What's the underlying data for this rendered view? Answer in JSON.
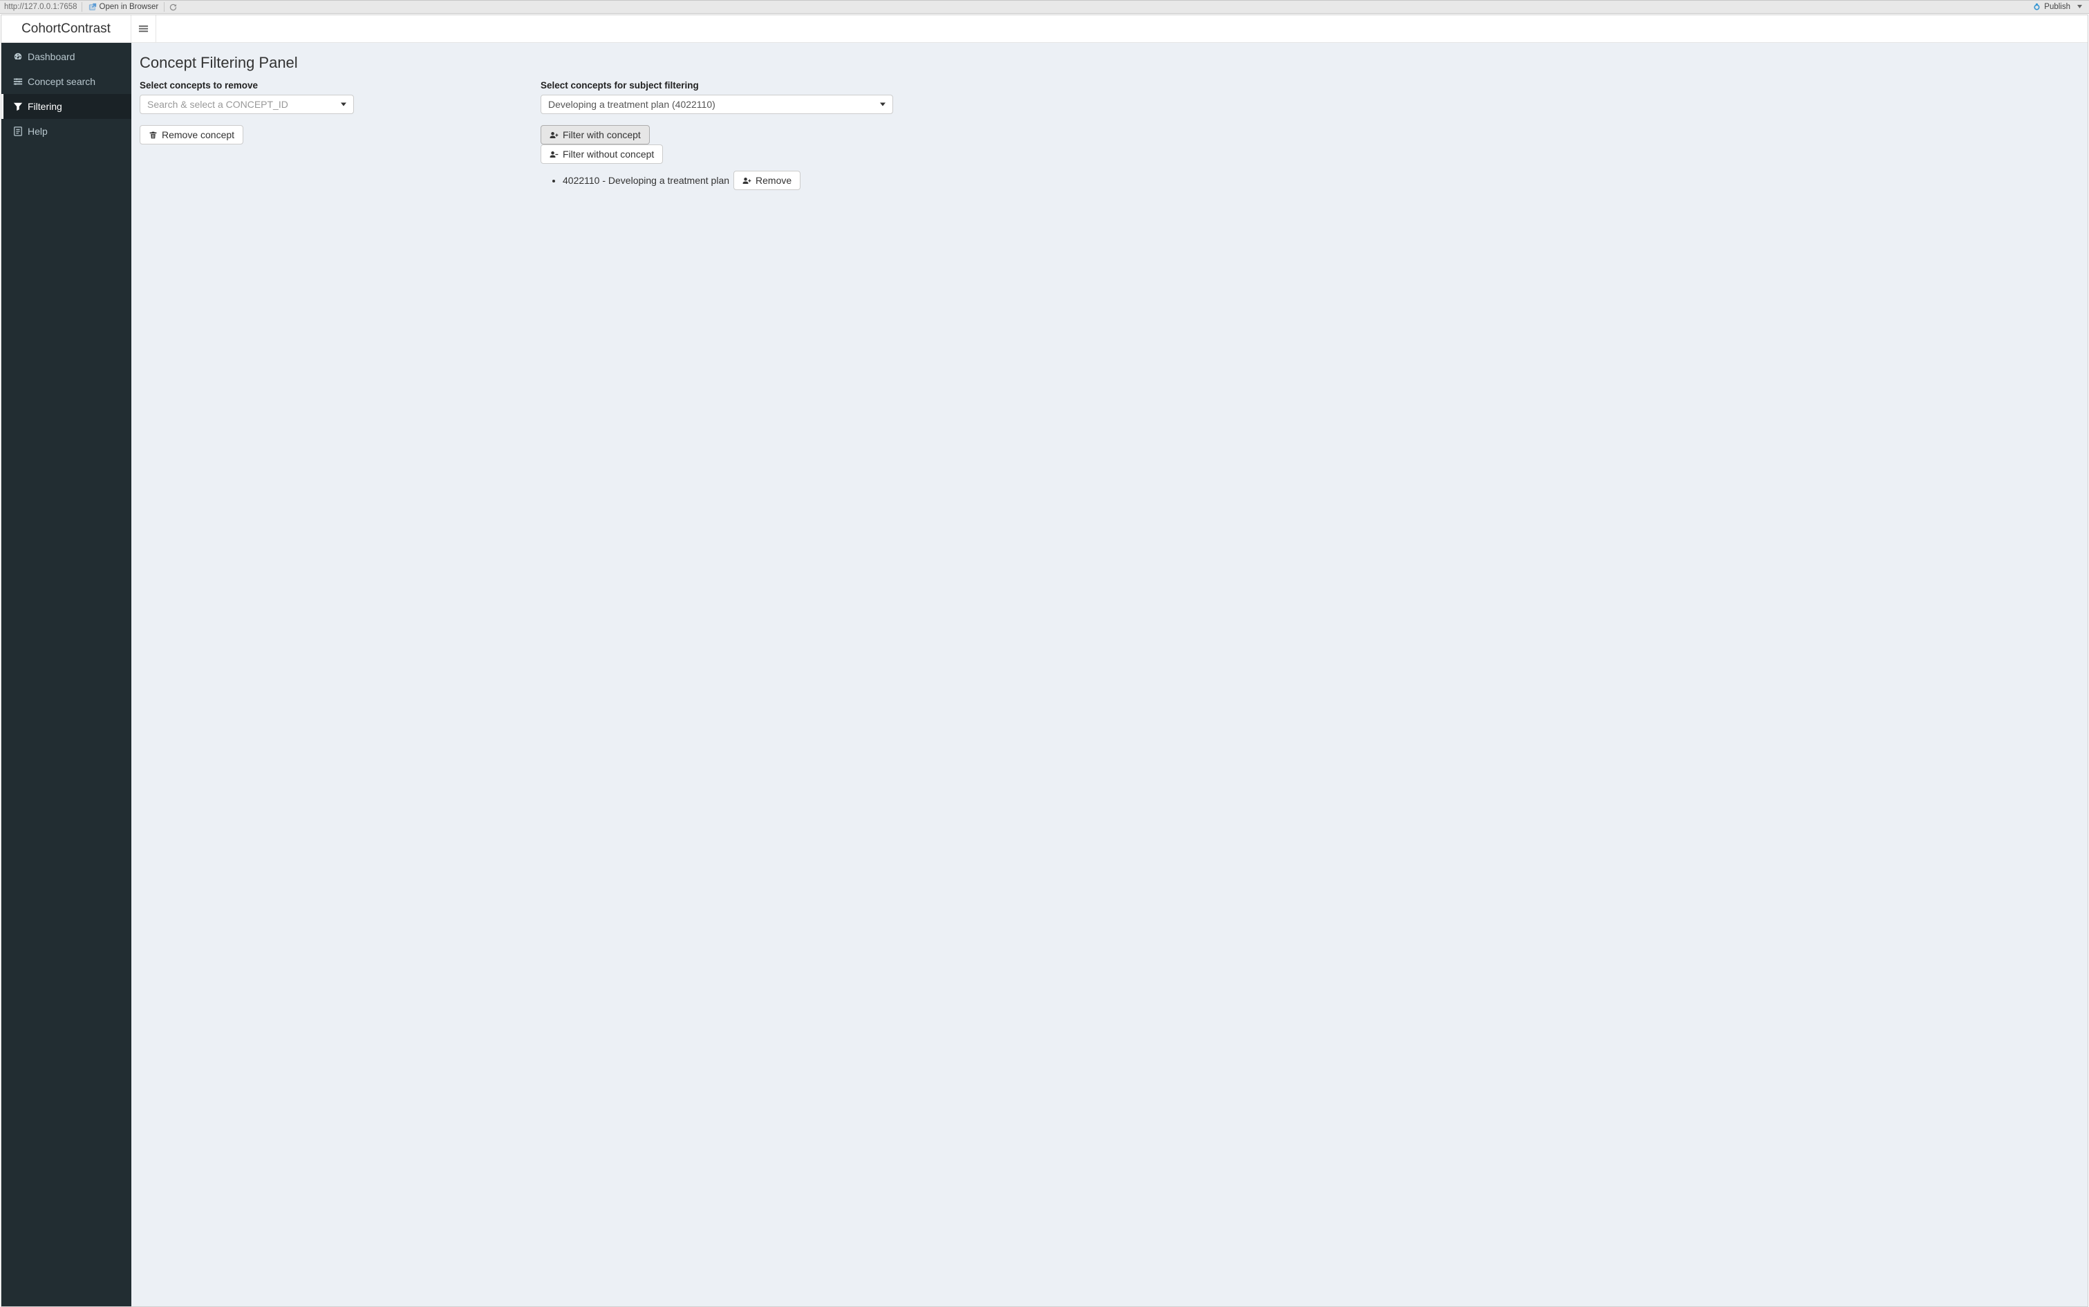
{
  "viewer": {
    "url": "http://127.0.0.1:7658",
    "open_in_browser": "Open in Browser",
    "publish": "Publish"
  },
  "brand": "CohortContrast",
  "sidebar": {
    "items": [
      {
        "label": "Dashboard"
      },
      {
        "label": "Concept search"
      },
      {
        "label": "Filtering"
      },
      {
        "label": "Help"
      }
    ],
    "active_index": 2
  },
  "page": {
    "title": "Concept Filtering Panel",
    "remove_section": {
      "label": "Select concepts to remove",
      "placeholder": "Search & select a CONCEPT_ID",
      "remove_button": "Remove concept"
    },
    "filter_section": {
      "label": "Select concepts for subject filtering",
      "selected": "Developing a treatment plan (4022110)",
      "filter_with": "Filter with concept",
      "filter_without": "Filter without concept",
      "applied": [
        {
          "text": "4022110 - Developing a treatment plan",
          "remove_label": "Remove"
        }
      ]
    }
  }
}
